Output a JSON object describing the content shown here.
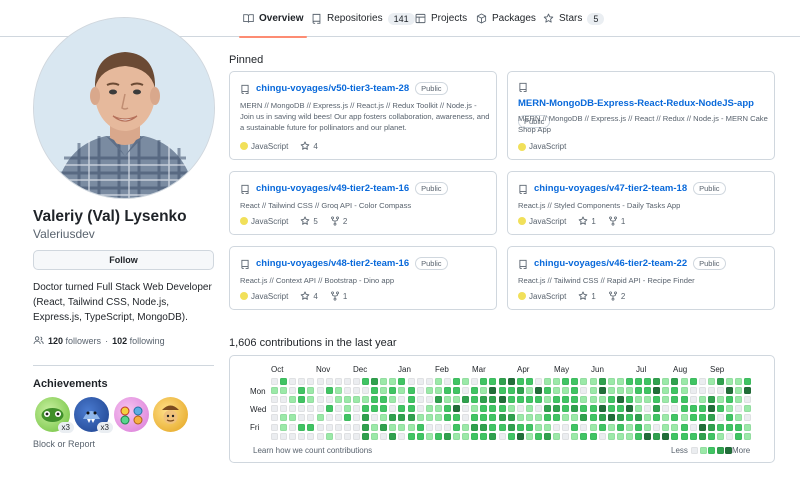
{
  "nav": {
    "tabs": [
      {
        "label": "Overview",
        "icon": "book-icon",
        "active": true
      },
      {
        "label": "Repositories",
        "icon": "repo-icon",
        "count": "141"
      },
      {
        "label": "Projects",
        "icon": "table-icon"
      },
      {
        "label": "Packages",
        "icon": "package-icon"
      },
      {
        "label": "Stars",
        "icon": "star-icon",
        "count": "5"
      }
    ]
  },
  "profile": {
    "name": "Valeriy (Val) Lysenko",
    "login": "Valeriusdev",
    "follow_label": "Follow",
    "bio": "Doctor turned Full Stack Web Developer (React, Tailwind CSS, Node.js, Express.js, TypeScript, MongoDB).",
    "followers_count": "120",
    "followers_label": "followers",
    "separator": "·",
    "following_count": "102",
    "following_label": "following"
  },
  "achievements": {
    "title": "Achievements",
    "badges": [
      {
        "name": "pair-extraordinaire",
        "count": "x3"
      },
      {
        "name": "pull-shark",
        "count": "x3"
      },
      {
        "name": "yolo",
        "count": ""
      },
      {
        "name": "quickdraw",
        "count": ""
      }
    ],
    "block_label": "Block or Report"
  },
  "pinned": {
    "title": "Pinned",
    "repos": [
      {
        "name": "chingu-voyages/v50-tier3-team-28",
        "visibility": "Public",
        "description": "MERN // MongoDB // Express.js // React.js // Redux Toolkit // Node.js - Join us in saving wild bees! Our app fosters collaboration, awareness, and a sustainable future for pollinators and our planet.",
        "language": "JavaScript",
        "stars": "4",
        "forks": ""
      },
      {
        "name": "MERN-MongoDB-Express-React-Redux-NodeJS-app",
        "visibility": "Public",
        "description": "MERN // MongoDB // Express.js // React // Redux // Node.js - MERN Cake Shop App",
        "language": "JavaScript",
        "stars": "",
        "forks": ""
      },
      {
        "name": "chingu-voyages/v49-tier2-team-16",
        "visibility": "Public",
        "description": "React // Tailwind CSS // Groq API - Color Compass",
        "language": "JavaScript",
        "stars": "5",
        "forks": "2"
      },
      {
        "name": "chingu-voyages/v47-tier2-team-18",
        "visibility": "Public",
        "description": "React.js // Styled Components - Daily Tasks App",
        "language": "JavaScript",
        "stars": "1",
        "forks": "1"
      },
      {
        "name": "chingu-voyages/v48-tier2-team-16",
        "visibility": "Public",
        "description": "React.js // Context API // Bootstrap - Dino app",
        "language": "JavaScript",
        "stars": "4",
        "forks": "1"
      },
      {
        "name": "chingu-voyages/v46-tier2-team-22",
        "visibility": "Public",
        "description": "React.js // Tailwind CSS // Rapid API - Recipe Finder",
        "language": "JavaScript",
        "stars": "1",
        "forks": "2"
      }
    ]
  },
  "contributions": {
    "title": "1,606 contributions in the last year",
    "months": [
      "Oct",
      "Nov",
      "Dec",
      "Jan",
      "Feb",
      "Mar",
      "Apr",
      "May",
      "Jun",
      "Jul",
      "Aug",
      "Sep"
    ],
    "weekdays": [
      "Mon",
      "Wed",
      "Fri"
    ],
    "learn_label": "Learn how we count contributions",
    "less_label": "Less",
    "more_label": "More",
    "colors": [
      "#ebedf0",
      "#9be9a8",
      "#40c463",
      "#30a14e",
      "#216e39"
    ]
  }
}
